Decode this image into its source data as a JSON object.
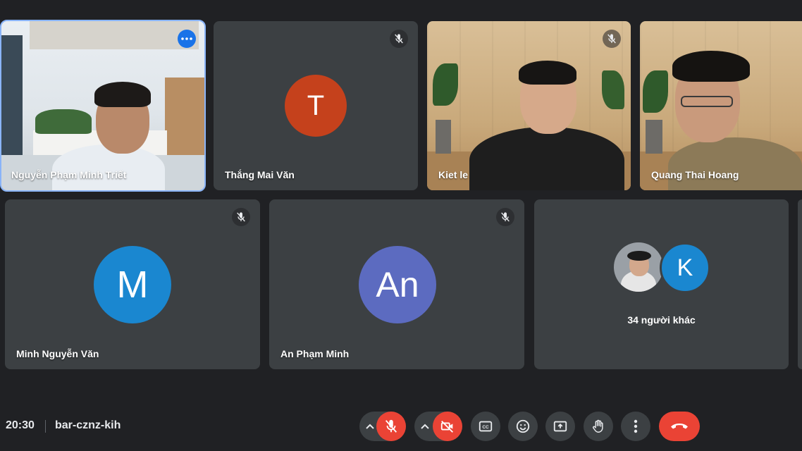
{
  "participants": [
    {
      "name": "Nguyễn Phạm Minh Triết",
      "type": "video",
      "pinned_menu": true
    },
    {
      "name": "Thắng Mai Văn",
      "type": "avatar",
      "initial": "T",
      "avatar_color": "#c5411c",
      "muted": true
    },
    {
      "name": "Kiet le",
      "type": "video",
      "muted": true
    },
    {
      "name": "Quang Thai Hoang",
      "type": "video"
    },
    {
      "name": "Minh Nguyễn Văn",
      "type": "avatar",
      "initial": "M",
      "avatar_color": "#1a87d0",
      "muted": true
    },
    {
      "name": "An Phạm Minh",
      "type": "avatar",
      "initial": "An",
      "avatar_color": "#5c6bc0",
      "muted": true
    }
  ],
  "others": {
    "initial": "K",
    "avatar_color": "#1a87d0",
    "label": "34 người khác"
  },
  "footer": {
    "time": "20:30",
    "meeting_code": "bar-cznz-kih"
  },
  "controls": [
    {
      "name": "microphone",
      "state": "off",
      "icon": "mic-off-icon"
    },
    {
      "name": "camera",
      "state": "off",
      "icon": "camera-off-icon"
    },
    {
      "name": "captions",
      "icon": "captions-icon"
    },
    {
      "name": "reactions",
      "icon": "emoji-icon"
    },
    {
      "name": "present",
      "icon": "present-icon"
    },
    {
      "name": "raise-hand",
      "icon": "hand-icon"
    },
    {
      "name": "more-options",
      "icon": "more-vert-icon"
    },
    {
      "name": "leave-call",
      "icon": "end-call-icon"
    }
  ],
  "colors": {
    "background": "#202124",
    "tile": "#3c4043",
    "accent": "#8ab4f8",
    "danger": "#ea4335"
  }
}
